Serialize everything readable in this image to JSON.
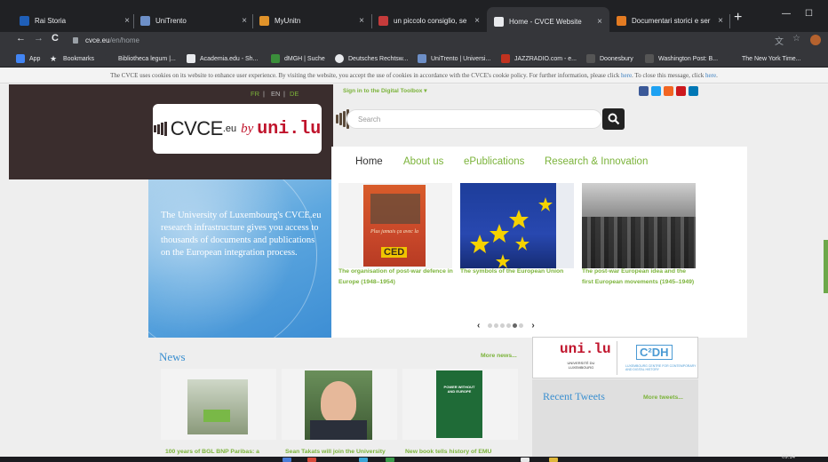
{
  "browser": {
    "tabs": [
      {
        "title": "Rai Storia",
        "color": "#1f5fb8",
        "active": false
      },
      {
        "title": "UniTrento",
        "color": "#6d8fc7",
        "active": false
      },
      {
        "title": "MyUnitn",
        "color": "#e0932a",
        "active": false
      },
      {
        "title": "un piccolo consiglio, se poss",
        "color": "#c53b3b",
        "active": false
      },
      {
        "title": "Home - CVCE Website",
        "color": "#e8eaed",
        "active": true
      },
      {
        "title": "Documentari storici e serie t",
        "color": "#e37b22",
        "active": false
      }
    ],
    "close_glyph": "×",
    "new_tab": "+",
    "window_controls": {
      "minimize": "—",
      "maximize": "☐"
    },
    "nav": {
      "back": "←",
      "forward": "→",
      "reload": "C"
    },
    "url_domain": "cvce.eu",
    "url_path": "/en/home",
    "bookmarks": [
      {
        "label": "App",
        "color": "#4285f4"
      },
      {
        "label": "Bookmarks",
        "color": "#e8eaed"
      },
      {
        "label": "Bibliotheca legum |...",
        "color": "#35363a"
      },
      {
        "label": "Academia.edu - Sh...",
        "color": "#e8eaed"
      },
      {
        "label": "dMGH | Suche",
        "color": "#3b8f3b"
      },
      {
        "label": "Deutsches Rechtsw...",
        "color": "#e8eaed"
      },
      {
        "label": "UniTrento | Universi...",
        "color": "#6d8fc7"
      },
      {
        "label": "JAZZRADIO.com - e...",
        "color": "#c0321f"
      },
      {
        "label": "Doonesbury",
        "color": "#555"
      },
      {
        "label": "Washington Post: B...",
        "color": "#555"
      },
      {
        "label": "The New York Time...",
        "color": "#35363a"
      }
    ]
  },
  "cookie_banner": {
    "text": "The CVCE uses cookies on its website to enhance user experience. By visiting the website, you accept the use of cookies in accordance with the CVCE's cookie policy. For further information, please click",
    "link1": "here",
    "middle": ". To close this message, click",
    "link2": "here",
    "end": "."
  },
  "header": {
    "languages": [
      "FR",
      "EN",
      "DE"
    ],
    "lang_sep": "|",
    "logo": {
      "cvce": "CVCE",
      "eu": ".eu",
      "by": "by",
      "uni": "uni.lu"
    },
    "signin": "Sign in to the Digital Toolbox ▾",
    "search_placeholder": "Search",
    "social_icons": [
      {
        "name": "facebook-icon",
        "color": "#3b5998"
      },
      {
        "name": "twitter-icon",
        "color": "#1da1f2"
      },
      {
        "name": "rss-icon",
        "color": "#f26522"
      },
      {
        "name": "youtube-icon",
        "color": "#cc181e"
      },
      {
        "name": "linkedin-icon",
        "color": "#0077b5"
      }
    ]
  },
  "nav": [
    "Home",
    "About us",
    "ePublications",
    "Research & Innovation"
  ],
  "intro_text": "The University of Luxembourg's CVCE.eu research infrastructure gives you access to thousands of documents and publications on the European integration process.",
  "carousel": {
    "slides": [
      {
        "caption": "The organisation of post-war defence in Europe (1948–1954)"
      },
      {
        "caption": "The symbols of the European Union"
      },
      {
        "caption": "The post-war European idea and the first European movements (1945–1949)"
      }
    ],
    "poster_text": "Plus jamais ça avec la",
    "poster_big": "CED",
    "prev": "‹",
    "next": "›",
    "dots": 6,
    "active_dot": 4
  },
  "partner_box": {
    "uni": "uni.lu",
    "uni_sub": "UNIVERSITÉ DU LUXEMBOURG",
    "c2dh": "C²DH",
    "c2dh_sub": "LUXEMBOURG CENTRE FOR CONTEMPORARY AND DIGITAL HISTORY"
  },
  "news": {
    "heading": "News",
    "more": "More news...",
    "items": [
      {
        "caption": "100 years of BGL BNP Paribas: a"
      },
      {
        "caption": "Sean Takats will join the University"
      },
      {
        "caption": "New book tells history of EMU"
      }
    ],
    "book_title": "POWER WITHOUT AND EUROPE"
  },
  "tweets": {
    "heading": "Recent Tweets",
    "more": "More tweets..."
  },
  "taskbar": {
    "clock": "09:14"
  },
  "colors": {
    "accent_green": "#7bb33a",
    "news_blue": "#3a8fd0",
    "brand_red": "#c0142c"
  }
}
